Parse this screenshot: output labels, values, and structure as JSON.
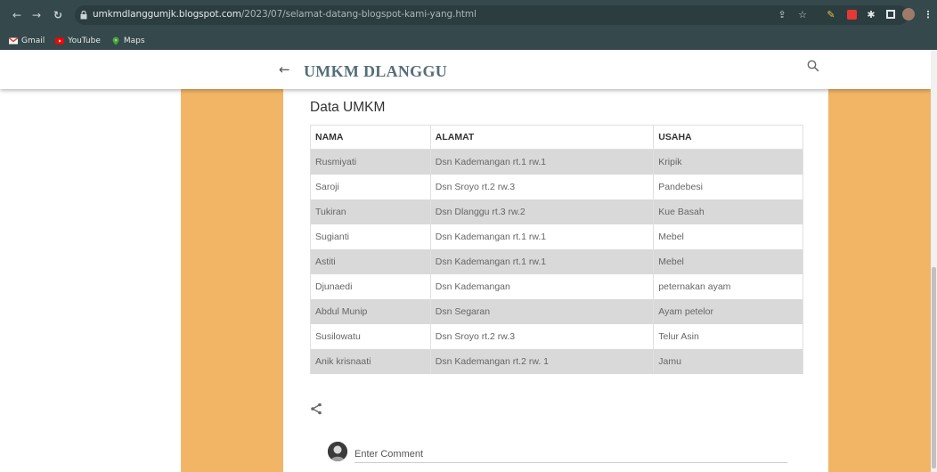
{
  "browser": {
    "url_domain": "umkmdlanggumjk.blogspot.com",
    "url_path": "/2023/07/selamat-datang-blogspot-kami-yang.html",
    "bookmarks": [
      {
        "label": "Gmail"
      },
      {
        "label": "YouTube"
      },
      {
        "label": "Maps"
      }
    ]
  },
  "header": {
    "title": "UMKM DLANGGU"
  },
  "main": {
    "section_title": "Data UMKM",
    "table": {
      "columns": [
        "NAMA",
        "ALAMAT",
        "USAHA"
      ],
      "rows": [
        [
          "Rusmiyati",
          "Dsn Kademangan rt.1 rw.1",
          "Kripik"
        ],
        [
          "Saroji",
          "Dsn Sroyo rt.2 rw.3",
          "Pandebesi"
        ],
        [
          "Tukiran",
          "Dsn Dlanggu rt.3 rw.2",
          "Kue Basah"
        ],
        [
          "Sugianti",
          "Dsn Kademangan rt.1 rw.1",
          "Mebel"
        ],
        [
          "Astiti",
          "Dsn Kademangan rt.1 rw.1",
          "Mebel"
        ],
        [
          "Djunaedi",
          "Dsn Kademangan",
          "peternakan ayam"
        ],
        [
          "Abdul Munip",
          "Dsn Segaran",
          "Ayam petelor"
        ],
        [
          "Susilowatu",
          "Dsn Sroyo rt.2 rw.3",
          "Telur Asin"
        ],
        [
          "Anik krisnaati",
          "Dsn Kademangan rt.2 rw. 1",
          "Jamu"
        ]
      ]
    },
    "comment_placeholder": "Enter Comment"
  },
  "colors": {
    "chrome": "#35484b",
    "side_accent": "#f2b566",
    "title_color": "#546e7a",
    "row_stripe": "#d9d9d9"
  }
}
